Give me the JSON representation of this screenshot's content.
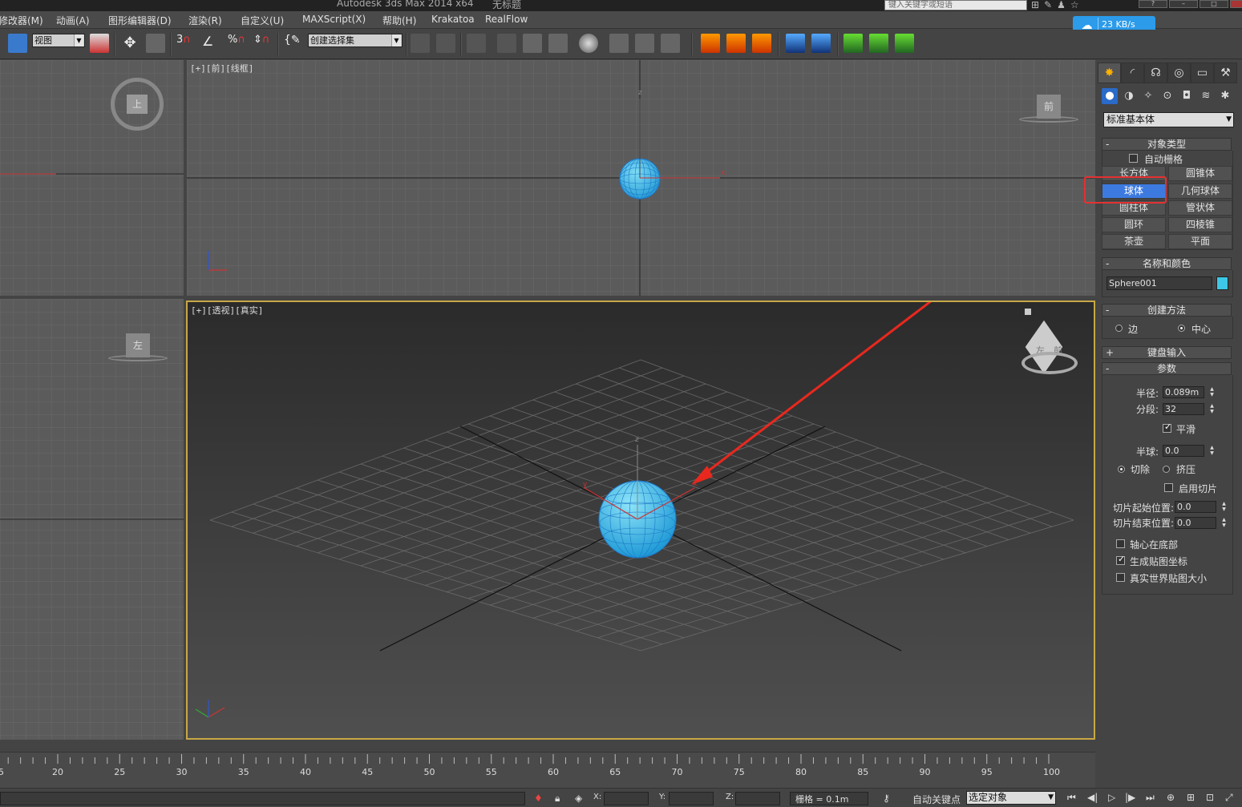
{
  "app": {
    "title": "Autodesk 3ds Max  2014 x64",
    "doc_title": "无标题",
    "search_placeholder": "键入关键字或短语"
  },
  "network_widget": {
    "speed": "23 KB/s"
  },
  "menu": {
    "items": [
      "修改器(M)",
      "动画(A)",
      "图形编辑器(D)",
      "渲染(R)",
      "自定义(U)",
      "MAXScript(X)",
      "帮助(H)",
      "Krakatoa",
      "RealFlow"
    ]
  },
  "toolbar": {
    "view_select": "视图",
    "selection_set": "创建选择集",
    "snap_labels": [
      "3",
      "%"
    ]
  },
  "viewports": {
    "top_left": {
      "nav_label": "上"
    },
    "top_center": {
      "label": "[+][前][线框]",
      "nav_label": "前",
      "axis_x": "x",
      "axis_z": "z"
    },
    "bottom_left": {
      "nav_label": "左"
    },
    "perspective": {
      "label": "[+][透视][真实]",
      "nav_left": "左",
      "nav_front": "前",
      "axis_x": "x",
      "axis_y": "y",
      "axis_z": "z"
    }
  },
  "command_panel": {
    "category": "标准基本体",
    "object_type": {
      "title": "对象类型",
      "auto_grid": "自动栅格",
      "buttons": [
        "长方体",
        "圆锥体",
        "球体",
        "几何球体",
        "圆柱体",
        "管状体",
        "圆环",
        "四棱锥",
        "茶壶",
        "平面"
      ],
      "selected": "球体"
    },
    "name_color": {
      "title": "名称和颜色",
      "name": "Sphere001",
      "color": "#3cc8e6"
    },
    "creation_method": {
      "title": "创建方法",
      "edge": "边",
      "center": "中心"
    },
    "keyboard_entry": {
      "title": "键盘输入"
    },
    "parameters": {
      "title": "参数",
      "radius_label": "半径:",
      "radius": "0.089m",
      "segments_label": "分段:",
      "segments": "32",
      "smooth": "平滑",
      "hemisphere_label": "半球:",
      "hemisphere": "0.0",
      "chop": "切除",
      "squash": "挤压",
      "slice_on": "启用切片",
      "slice_from_label": "切片起始位置:",
      "slice_from": "0.0",
      "slice_to_label": "切片结束位置:",
      "slice_to": "0.0",
      "base_to_pivot": "轴心在底部",
      "gen_mapping": "生成贴图坐标",
      "real_world": "真实世界贴图大小"
    }
  },
  "timeline": {
    "ticks": [
      {
        "v": "5"
      },
      {
        "v": "20"
      },
      {
        "v": "25"
      },
      {
        "v": "30"
      },
      {
        "v": "35"
      },
      {
        "v": "40"
      },
      {
        "v": "45"
      },
      {
        "v": "50"
      },
      {
        "v": "55"
      },
      {
        "v": "60"
      },
      {
        "v": "65"
      },
      {
        "v": "70"
      },
      {
        "v": "75"
      },
      {
        "v": "80"
      },
      {
        "v": "85"
      },
      {
        "v": "90"
      },
      {
        "v": "95"
      },
      {
        "v": "100"
      }
    ]
  },
  "status": {
    "x_label": "X:",
    "y_label": "Y:",
    "z_label": "Z:",
    "grid": "栅格 = 0.1m",
    "auto_key": "自动关键点",
    "selected": "选定对象"
  }
}
